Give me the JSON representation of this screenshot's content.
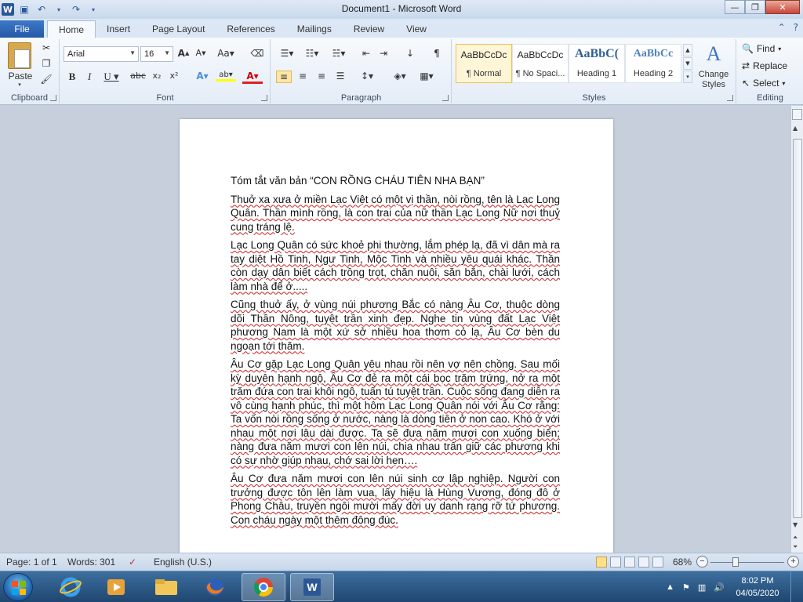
{
  "window": {
    "title": "Document1  -  Microsoft Word",
    "app_icon": "word-icon",
    "controls": {
      "minimize": "—",
      "restore": "❐",
      "close": "✕"
    }
  },
  "quick_access": {
    "save_icon": "save-icon",
    "undo_icon": "undo-icon",
    "redo_icon": "redo-icon",
    "customize_icon": "chevron-down-icon"
  },
  "tabs": [
    "File",
    "Home",
    "Insert",
    "Page Layout",
    "References",
    "Mailings",
    "Review",
    "View"
  ],
  "active_tab": "Home",
  "ribbon": {
    "clipboard": {
      "label": "Clipboard",
      "paste": "Paste"
    },
    "font": {
      "label": "Font",
      "font_name": "Arial",
      "font_size": "16"
    },
    "paragraph": {
      "label": "Paragraph"
    },
    "styles": {
      "label": "Styles",
      "items": [
        {
          "sample": "AaBbCcDc",
          "name": "¶ Normal"
        },
        {
          "sample": "AaBbCcDc",
          "name": "¶ No Spaci..."
        },
        {
          "sample": "AaBbC(",
          "name": "Heading 1"
        },
        {
          "sample": "AaBbCc",
          "name": "Heading 2"
        }
      ],
      "change_styles_1": "Change",
      "change_styles_2": "Styles"
    },
    "editing": {
      "label": "Editing",
      "find": "Find",
      "replace": "Replace",
      "select": "Select"
    }
  },
  "document": {
    "paragraphs": [
      "Tóm tắt văn bản “CON RỒNG CHÁU TIÊN NHA BẠN”",
      "Thuở xa xưa ở miền Lạc Việt có một vị thần, nòi rồng, tên là Lạc Long Quân. Thần mình rồng, là con trai của nữ thần Lạc Long Nữ nơi thuỷ cung tráng lệ.",
      "Lạc Long Quân có sức khoẻ phi thường, lắm phép lạ, đã vì dân mà ra tay diệt Hồ Tinh, Ngư Tinh, Mộc Tinh và nhiều yêu quái khác. Thần còn dạy dân biết cách trồng trọt, chăn nuôi, săn bắn, chài lưới, cách làm nhà để ở.....",
      "Cũng thuở ấy, ở vùng núi phương Bắc có nàng Âu Cơ, thuộc dòng dõi Thần Nông, tuyệt trần xinh đẹp. Nghe tin vùng đất Lạc Việt phương Nam là một xứ sở nhiều hoa thơm cỏ lạ, Âu Cơ bèn du ngoạn tới thăm.",
      "Âu Cơ gặp Lạc Long Quân yêu nhau rồi nên vợ nên chồng. Sau mối kỳ duyên hạnh ngộ, Âu Cơ đẻ ra một cái bọc trăm trứng, nở ra một trăm đứa con trai khôi ngô, tuấn tú tuyệt trần. Cuộc sống đang diễn ra vô cùng hạnh phúc, thì một hôm Lạc Long Quân nói với Âu Cơ rằng: Ta vốn nòi rồng sống ở nước, nàng là dòng tiên ở non cao. Khó ở với nhau một nơi lâu dài được. Ta sẽ đưa năm mươi con xuống biển; nàng đưa năm mươi con lên núi, chia nhau trấn giữ các phương khi có sự nhờ giúp nhau, chớ sai lời hẹn….",
      "Âu Cơ đưa năm mươi con lên núi sinh cơ lập nghiệp. Người con trưởng được tôn lên làm vua, lấy hiệu là Hùng Vương, đóng đô ở Phong Châu, truyền ngôi mười mấy đời uy danh rạng rỡ tứ phương. Con cháu ngày một thêm đông đúc."
    ]
  },
  "statusbar": {
    "page": "Page: 1 of 1",
    "words": "Words: 301",
    "language": "English (U.S.)",
    "zoom": "68%",
    "zoom_minus": "−",
    "zoom_plus": "+"
  },
  "taskbar": {
    "apps": [
      "internet-explorer-icon",
      "media-player-icon",
      "file-explorer-icon",
      "firefox-icon",
      "chrome-icon",
      "word-icon"
    ],
    "time": "8:02 PM",
    "date": "04/05/2020"
  }
}
